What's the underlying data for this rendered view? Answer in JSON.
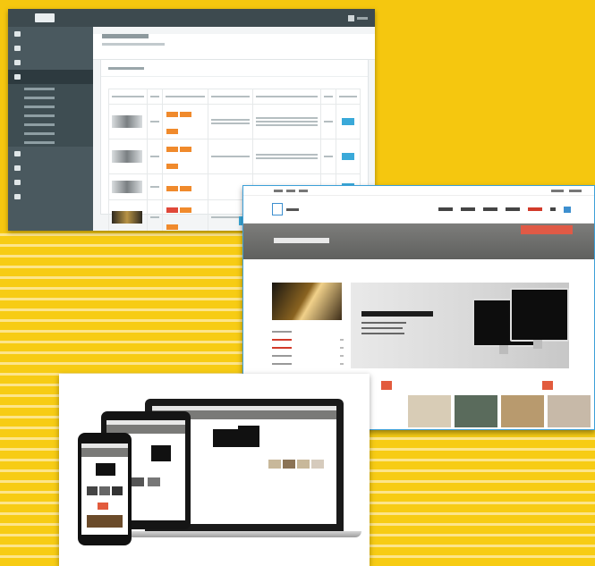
{
  "background": {
    "color": "#f5c70f",
    "stripe_color": "#fde58a"
  },
  "windows": [
    {
      "name": "admin-dashboard",
      "accent": "#3aa9d9",
      "sidebar_color": "#4a595f",
      "tag_colors": [
        "#f08a2c",
        "#e0483a"
      ]
    },
    {
      "name": "storefront",
      "accent": "#d23a2a",
      "banner_color": "#6c6c6a"
    },
    {
      "name": "responsive-devices",
      "devices": [
        "laptop",
        "tablet",
        "phone"
      ]
    }
  ]
}
